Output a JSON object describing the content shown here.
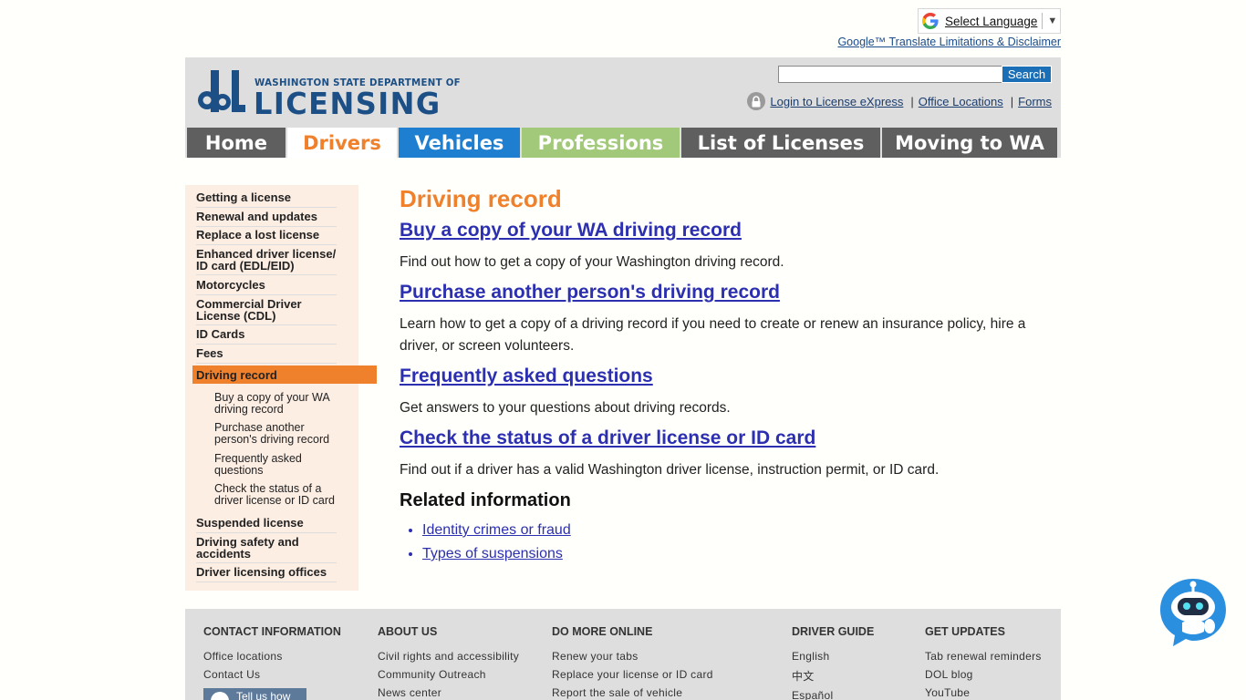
{
  "translate": {
    "select_language": "Select Language",
    "disclaimer": "Google™ Translate Limitations & Disclaimer"
  },
  "header": {
    "logo_small": "WASHINGTON STATE DEPARTMENT OF",
    "logo_big": "LICENSING",
    "search_button": "Search",
    "search_placeholder": "",
    "login": "Login to License eXpress",
    "offices": "Office Locations",
    "forms": "Forms",
    "sep": "|"
  },
  "nav": {
    "tabs": [
      "Home",
      "Drivers",
      "Vehicles",
      "Professions",
      "List of Licenses",
      "Moving to WA"
    ]
  },
  "sidebar": {
    "items": [
      "Getting a license",
      "Renewal and updates",
      "Replace a lost license",
      "Enhanced driver license/ ID card (EDL/EID)",
      "Motorcycles",
      "Commercial Driver License (CDL)",
      "ID Cards",
      "Fees",
      "Driving record",
      "Suspended license",
      "Driving safety and accidents",
      "Driver licensing offices"
    ],
    "sub_items": [
      "Buy a copy of your WA driving record",
      "Purchase another person's driving record",
      "Frequently asked questions",
      "Check the status of a driver license or ID card"
    ]
  },
  "content": {
    "title": "Driving record",
    "sections": [
      {
        "link": "Buy a copy of your WA driving record",
        "text": "Find out how to get a copy of your Washington driving record."
      },
      {
        "link": "Purchase another person's driving record",
        "text": "Learn how to get a copy of a driving record if you need to create or renew an insurance policy, hire a driver, or screen volunteers."
      },
      {
        "link": "Frequently asked questions",
        "text": "Get answers to your questions about driving records."
      },
      {
        "link": "Check the status of a driver license or ID card",
        "text": "Find out if a driver has a valid Washington driver license, instruction permit, or ID card."
      }
    ],
    "related_title": "Related information",
    "related_links": [
      "Identity crimes or fraud",
      "Types of suspensions"
    ]
  },
  "footer": {
    "columns": [
      {
        "heading": "CONTACT INFORMATION",
        "links": [
          "Office locations",
          "Contact Us"
        ]
      },
      {
        "heading": "ABOUT US",
        "links": [
          "Civil rights and accessibility",
          "Community Outreach",
          "News center"
        ]
      },
      {
        "heading": "DO MORE ONLINE",
        "links": [
          "Renew your tabs",
          "Replace your license or ID card",
          "Report the sale of vehicle"
        ]
      },
      {
        "heading": "DRIVER GUIDE",
        "links": [
          "English",
          "中文",
          "Español"
        ]
      },
      {
        "heading": "GET UPDATES",
        "links": [
          "Tab renewal reminders",
          "DOL blog",
          "YouTube"
        ]
      }
    ],
    "tell_us": "Tell us how"
  },
  "colors": {
    "accent_orange": "#f0812c",
    "brand_blue": "#1b4f86",
    "vehicles_blue": "#1e7ed0",
    "professions_green": "#a2c97a",
    "nav_gray": "#5f5f5f",
    "link_blue": "#2b2fb0"
  },
  "icons": {
    "google": "google-g-icon",
    "lock": "lock-icon",
    "chatbot": "chatbot-robot-icon"
  }
}
